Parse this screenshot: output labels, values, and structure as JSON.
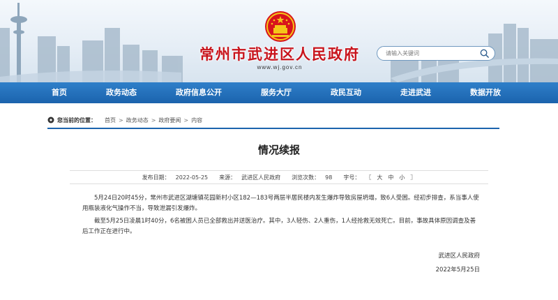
{
  "header": {
    "site_title": "常州市武进区人民政府",
    "site_domain": "www.wj.gov.cn",
    "search_placeholder": "请输入关键词",
    "title_color": "#c8141c"
  },
  "nav": {
    "items": [
      "首页",
      "政务动态",
      "政府信息公开",
      "服务大厅",
      "政民互动",
      "走进武进",
      "数据开放"
    ],
    "bg_color": "#1b63ad"
  },
  "breadcrumb": {
    "label": "您当前的位置：",
    "items": [
      "首页",
      "政务动态",
      "政府要闻",
      "内容"
    ],
    "separator": ">"
  },
  "article": {
    "title": "情况续报",
    "meta": {
      "publish_label": "发布日期：",
      "publish_date": "2022-05-25",
      "source_label": "来源：",
      "source": "武进区人民政府",
      "views_label": "浏览次数：",
      "views": "98",
      "fontsize_label": "字号：",
      "bracket_open": "〖",
      "fontsize_large": "大",
      "fontsize_medium": "中",
      "fontsize_small": "小",
      "bracket_close": "〗"
    },
    "paragraphs": [
      "5月24日20时45分，常州市武进区湖塘镇花园新村小区182—183号两层半居民楼内发生爆炸导致房屋坍塌，致6人受困。经初步排查，系当事人使用瓶装液化气操作不当，导致泄漏引发爆炸。",
      "截至5月25日凌晨1时40分，6名被困人员已全部救出并送医治疗。其中，3人轻伤、2人重伤，1人经抢救无效死亡。目前，事故具体原因调查及善后工作正在进行中。"
    ],
    "signature_org": "武进区人民政府",
    "signature_date": "2022年5月25日"
  }
}
